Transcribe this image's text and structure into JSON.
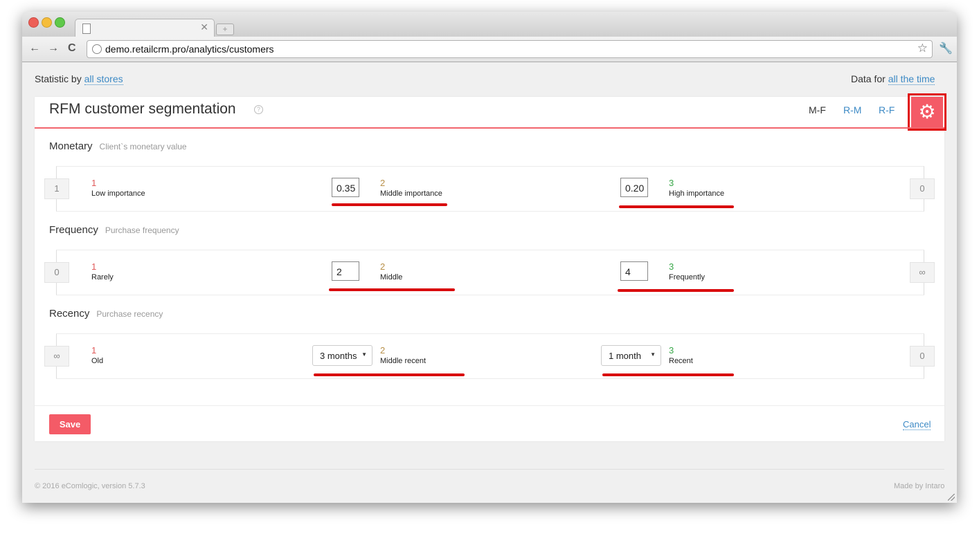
{
  "browser": {
    "url": "demo.retailcrm.pro/analytics/customers"
  },
  "topbar": {
    "statistic_prefix": "Statistic by",
    "statistic_link": "all stores",
    "data_prefix": "Data for",
    "data_link": "all the time"
  },
  "card": {
    "title": "RFM customer segmentation",
    "views": [
      "M-F",
      "R-M",
      "R-F"
    ],
    "active_view": "M-F",
    "settings_icon": "gear-icon",
    "accent_color": "#f45b67"
  },
  "sections": {
    "monetary": {
      "title": "Monetary",
      "subtitle": "Client`s monetary value",
      "left_end": "1",
      "right_end": "0",
      "segments": [
        {
          "num": "1",
          "label": "Low importance"
        },
        {
          "num": "2",
          "label": "Middle importance"
        },
        {
          "num": "3",
          "label": "High importance"
        }
      ],
      "inputs": [
        "0.35",
        "0.20"
      ]
    },
    "frequency": {
      "title": "Frequency",
      "subtitle": "Purchase frequency",
      "left_end": "0",
      "right_end": "∞",
      "segments": [
        {
          "num": "1",
          "label": "Rarely"
        },
        {
          "num": "2",
          "label": "Middle"
        },
        {
          "num": "3",
          "label": "Frequently"
        }
      ],
      "inputs": [
        "2",
        "4"
      ]
    },
    "recency": {
      "title": "Recency",
      "subtitle": "Purchase recency",
      "left_end": "∞",
      "right_end": "0",
      "segments": [
        {
          "num": "1",
          "label": "Old"
        },
        {
          "num": "2",
          "label": "Middle recent"
        },
        {
          "num": "3",
          "label": "Recent"
        }
      ],
      "selects": [
        "3 months",
        "1 month"
      ]
    }
  },
  "actions": {
    "save": "Save",
    "cancel": "Cancel"
  },
  "footer": {
    "copyright": "© 2016  eComlogic, version 5.7.3",
    "madeby": "Made by Intaro"
  }
}
